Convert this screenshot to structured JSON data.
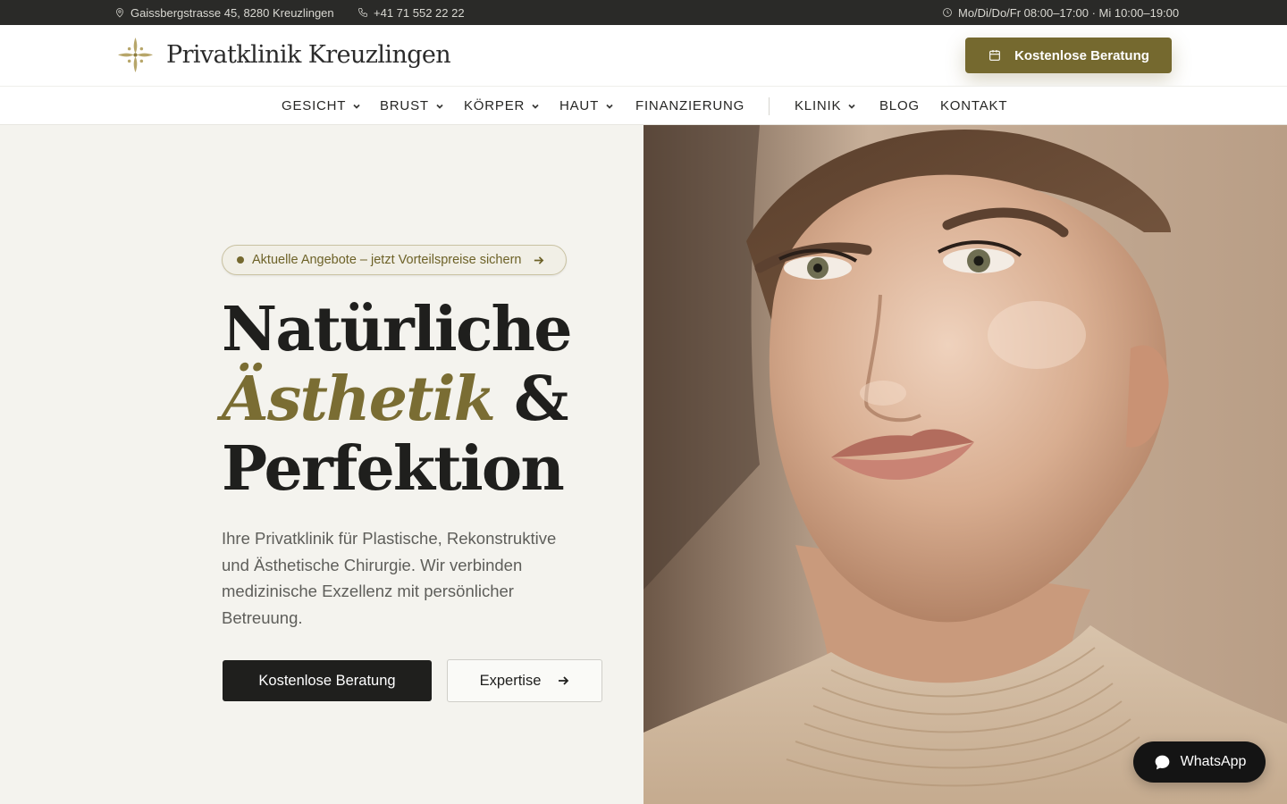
{
  "topbar": {
    "address": "Gaissbergstrasse 45, 8280 Kreuzlingen",
    "phone": "+41 71 552 22 22",
    "hours": "Mo/Di/Do/Fr 08:00–17:00 · Mi 10:00–19:00"
  },
  "header": {
    "logo_text": "Privatklinik Kreuzlingen",
    "cta_label": "Kostenlose Beratung"
  },
  "nav": {
    "items": [
      {
        "label": "GESICHT",
        "has_dropdown": true
      },
      {
        "label": "BRUST",
        "has_dropdown": true
      },
      {
        "label": "KÖRPER",
        "has_dropdown": true
      },
      {
        "label": "HAUT",
        "has_dropdown": true
      },
      {
        "label": "FINANZIERUNG",
        "has_dropdown": false
      },
      {
        "label": "KLINIK",
        "has_dropdown": true
      },
      {
        "label": "BLOG",
        "has_dropdown": false
      },
      {
        "label": "KONTAKT",
        "has_dropdown": false
      }
    ]
  },
  "hero": {
    "promo": "Aktuelle Angebote – jetzt Vorteilspreise sichern",
    "headline_line1": "Natürliche",
    "headline_accent": "Ästhetik",
    "headline_amp": "&",
    "headline_line3": "Perfektion",
    "lead": "Ihre Privatklinik für Plastische, Rekonstruktive und Ästhetische Chirurgie. Wir verbinden medizinische Exzellenz mit persönlicher Betreuung.",
    "primary_button": "Kostenlose Beratung",
    "secondary_button": "Expertise"
  },
  "whatsapp": {
    "label": "WhatsApp"
  },
  "colors": {
    "accent": "#75692f",
    "dark": "#1f1f1d",
    "background": "#f4f3ee",
    "topbar": "#2a2a28"
  },
  "icons": {
    "address": "map-pin-icon",
    "phone": "phone-icon",
    "hours": "clock-icon",
    "cta": "calendar-icon",
    "dropdown": "chevron-down-icon",
    "arrow": "arrow-right-icon",
    "whatsapp": "chat-bubble-icon"
  }
}
